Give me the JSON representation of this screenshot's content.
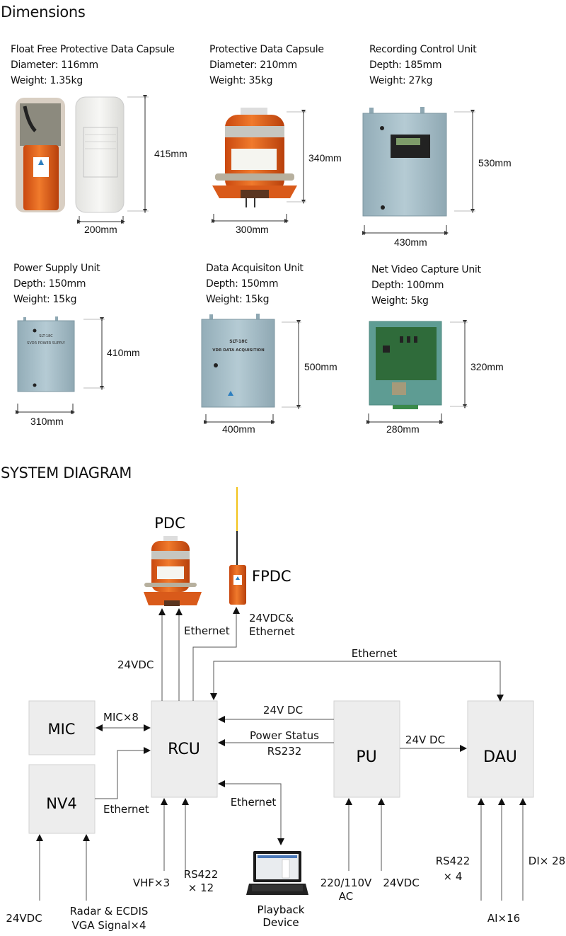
{
  "dimensions": {
    "title": "Dimensions",
    "products": [
      {
        "name": "Float Free Protective Data Capsule",
        "spec1": "Diameter: 116mm",
        "spec2": "Weight: 1.35kg",
        "height": "415mm",
        "width": "200mm"
      },
      {
        "name": "Protective Data Capsule",
        "spec1": "Diameter: 210mm",
        "spec2": "Weight: 35kg",
        "height": "340mm",
        "width": "300mm"
      },
      {
        "name": "Recording Control Unit",
        "spec1": "Depth: 185mm",
        "spec2": "Weight: 27kg",
        "height": "530mm",
        "width": "430mm"
      },
      {
        "name": "Power Supply Unit",
        "spec1": "Depth: 150mm",
        "spec2": "Weight: 15kg",
        "height": "410mm",
        "width": "310mm"
      },
      {
        "name": "Data Acquisiton Unit",
        "spec1": "Depth: 150mm",
        "spec2": "Weight: 15kg",
        "height": "500mm",
        "width": "400mm"
      },
      {
        "name": "Net Video Capture Unit",
        "spec1": "Depth: 100mm",
        "spec2": "Weight: 5kg",
        "height": "320mm",
        "width": "280mm"
      }
    ],
    "labels": {
      "psu_model": "SLT-18C",
      "psu_text": "SVDR POWER SUPPLY",
      "dau_model": "SLT-18C",
      "dau_text": "VDR DATA ACQUISITION"
    }
  },
  "system": {
    "title": "SYSTEM DIAGRAM",
    "nodes": {
      "mic": "MIC",
      "nv4": "NV4",
      "rcu": "RCU",
      "pu": "PU",
      "dau": "DAU",
      "pdc": "PDC",
      "fpdc": "FPDC",
      "playback1": "Playback",
      "playback2": "Device"
    },
    "links": {
      "pdc_24vdc": "24VDC",
      "pdc_eth": "Ethernet",
      "fpdc1": "24VDC&",
      "fpdc2": "Ethernet",
      "dau_eth": "Ethernet",
      "mic": "MIC×8",
      "nv4_eth": "Ethernet",
      "pu_24v": "24V DC",
      "pu_status1": "Power Status",
      "pu_status2": "RS232",
      "pu_dau": "24V DC",
      "playback_eth": "Ethernet"
    },
    "inputs": {
      "nv4_24": "24VDC",
      "radar1": "Radar & ECDIS",
      "radar2": "VGA Signal×4",
      "vhf": "VHF×3",
      "rs422_1": "RS422",
      "rs422_2": "× 12",
      "ac1": "220/110V",
      "ac2": "AC",
      "pu_24": "24VDC",
      "dau_rs1": "RS422",
      "dau_rs2": "× 4",
      "ai": "AI×16",
      "di": "DI× 28"
    },
    "colors": {
      "box": "#ededed",
      "box_border": "#cfcfcf",
      "line": "#555555",
      "orange": "#e8651e",
      "panel": "#a9c2cc"
    }
  }
}
